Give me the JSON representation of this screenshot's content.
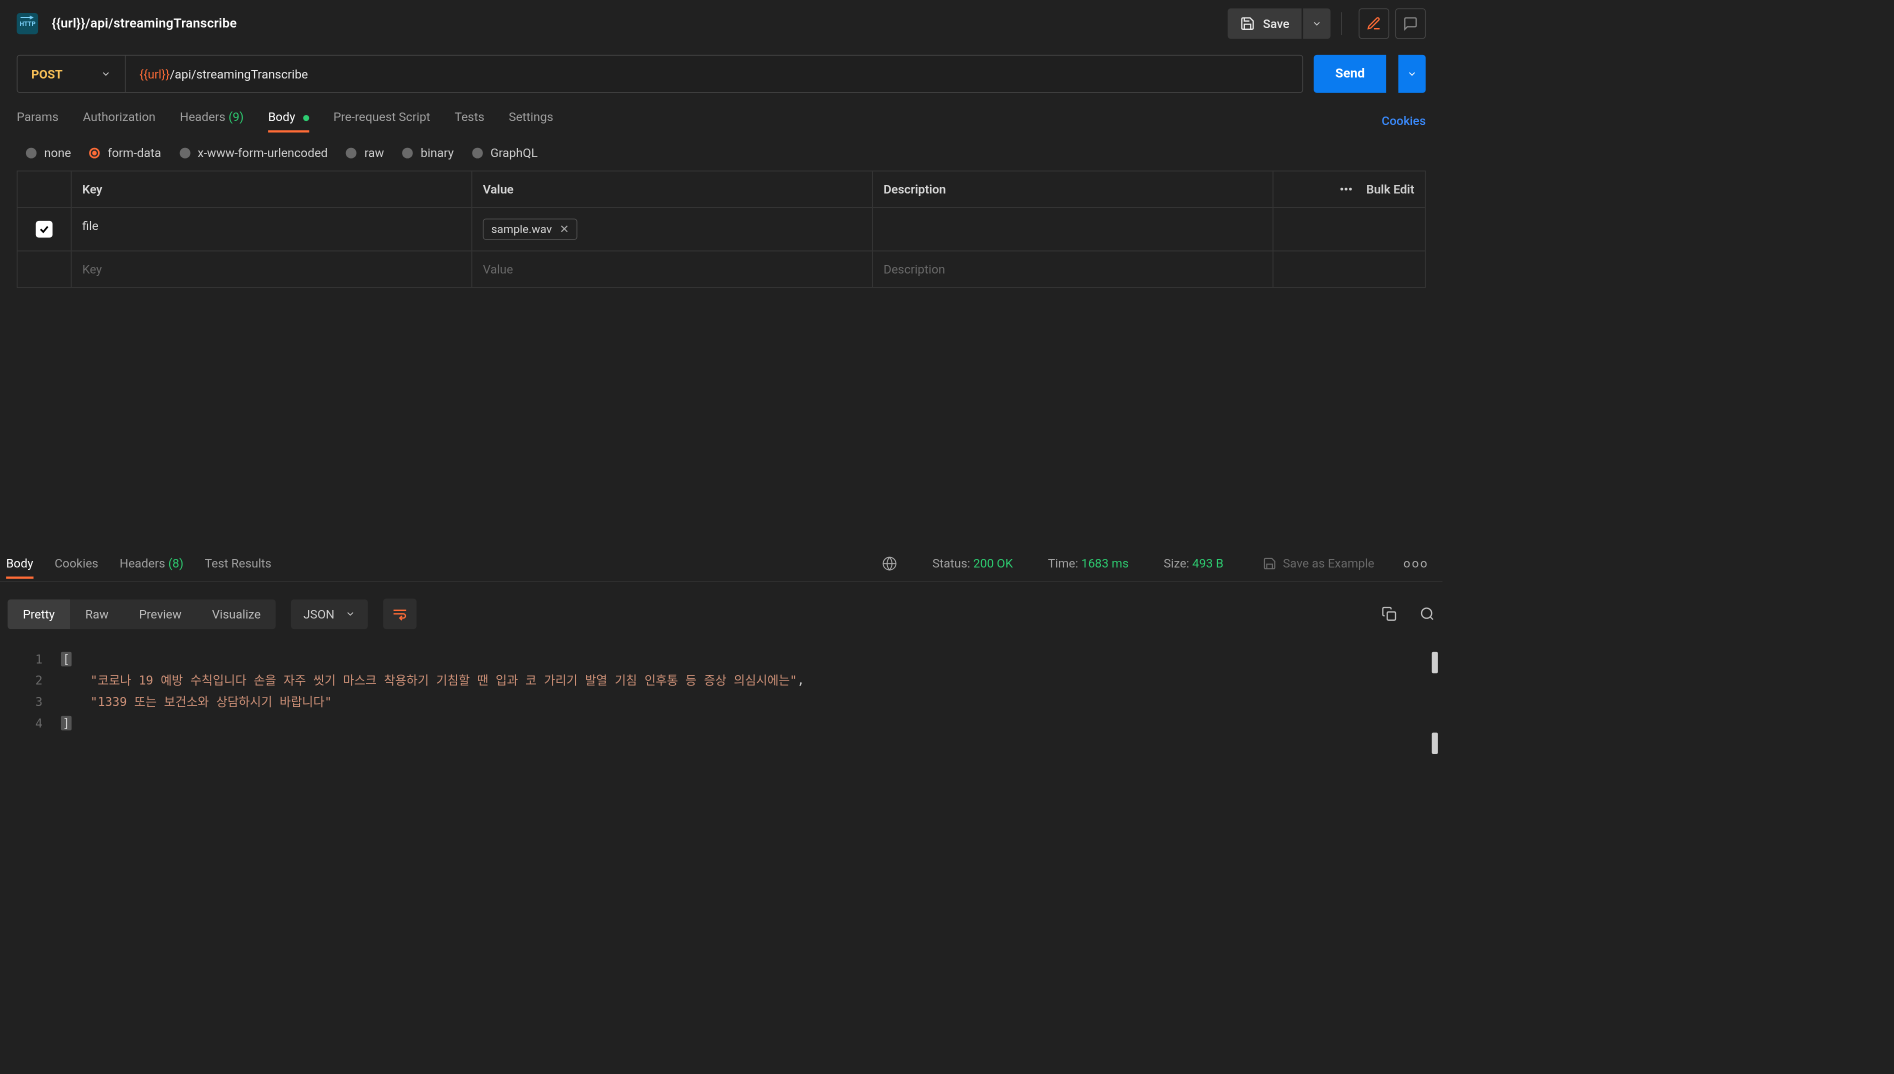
{
  "header": {
    "request_title": "{{url}}/api/streamingTranscribe",
    "save_label": "Save"
  },
  "urlbar": {
    "method": "POST",
    "url_variable": "{{url}}",
    "url_path": "/api/streamingTranscribe",
    "send_label": "Send"
  },
  "req_tabs": {
    "params": "Params",
    "authorization": "Authorization",
    "headers": "Headers",
    "headers_count": "(9)",
    "body": "Body",
    "pre_request": "Pre-request Script",
    "tests": "Tests",
    "settings": "Settings",
    "cookies": "Cookies"
  },
  "body_types": {
    "none": "none",
    "form_data": "form-data",
    "urlencoded": "x-www-form-urlencoded",
    "raw": "raw",
    "binary": "binary",
    "graphql": "GraphQL"
  },
  "fd_table": {
    "header": {
      "key": "Key",
      "value": "Value",
      "description": "Description",
      "bulk_edit": "Bulk Edit",
      "triple_dot": "•••"
    },
    "rows": [
      {
        "enabled": true,
        "key": "file",
        "file_name": "sample.wav"
      }
    ],
    "placeholders": {
      "key": "Key",
      "value": "Value",
      "description": "Description"
    }
  },
  "resp_tabs": {
    "body": "Body",
    "cookies": "Cookies",
    "headers": "Headers",
    "headers_count": "(8)",
    "test_results": "Test Results",
    "status_label": "Status:",
    "status_value": "200 OK",
    "time_label": "Time:",
    "time_value": "1683 ms",
    "size_label": "Size:",
    "size_value": "493 B",
    "save_example": "Save as Example"
  },
  "resp_toolbar": {
    "pretty": "Pretty",
    "raw": "Raw",
    "preview": "Preview",
    "visualize": "Visualize",
    "format": "JSON"
  },
  "response_body": {
    "lines": [
      {
        "n": "1",
        "content": "[",
        "type": "bracket"
      },
      {
        "n": "2",
        "content": "    \"코로나 19 예방 수칙입니다 손을 자주 씻기 마스크 착용하기 기침할 땐 입과 코 가리기 발열 기침 인후통 등 증상 의심시에는\",",
        "type": "str_comma"
      },
      {
        "n": "3",
        "content": "    \"1339 또는 보건소와 상담하시기 바랍니다\"",
        "type": "str"
      },
      {
        "n": "4",
        "content": "]",
        "type": "bracket"
      }
    ]
  }
}
